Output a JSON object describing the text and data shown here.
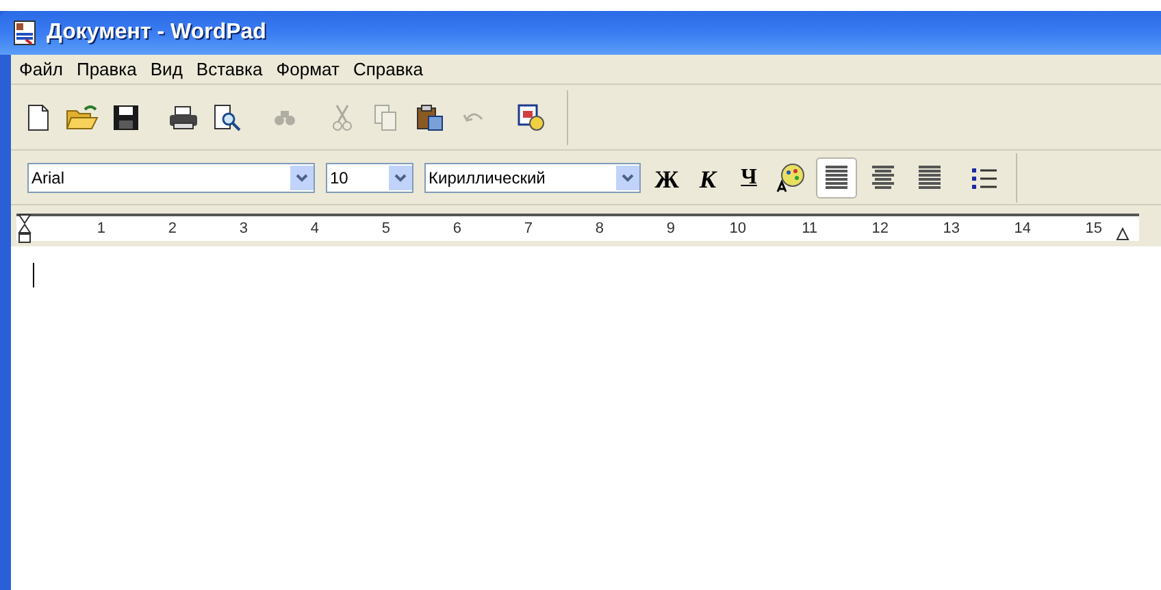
{
  "window": {
    "title": "Документ - WordPad"
  },
  "menu": [
    "Файл",
    "Правка",
    "Вид",
    "Вставка",
    "Формат",
    "Справка"
  ],
  "toolbar": [
    {
      "kind": "new",
      "disabled": false
    },
    {
      "kind": "open",
      "disabled": false
    },
    {
      "kind": "save",
      "disabled": false
    },
    {
      "kind": "sep"
    },
    {
      "kind": "print",
      "disabled": false
    },
    {
      "kind": "preview",
      "disabled": false
    },
    {
      "kind": "sep"
    },
    {
      "kind": "find",
      "disabled": true
    },
    {
      "kind": "sep"
    },
    {
      "kind": "cut",
      "disabled": true
    },
    {
      "kind": "copy",
      "disabled": true
    },
    {
      "kind": "paste",
      "disabled": false
    },
    {
      "kind": "undo",
      "disabled": true
    },
    {
      "kind": "sep"
    },
    {
      "kind": "datetime",
      "disabled": false
    }
  ],
  "format_bar": {
    "font": "Arial",
    "size": "10",
    "script": "Кириллический",
    "bold": "Ж",
    "italic": "К",
    "underline": "Ч",
    "align": [
      {
        "kind": "left",
        "selected": true
      },
      {
        "kind": "center",
        "selected": false
      },
      {
        "kind": "right",
        "selected": false
      }
    ]
  },
  "ruler": [
    "1",
    "2",
    "3",
    "4",
    "5",
    "6",
    "7",
    "8",
    "9",
    "10",
    "11",
    "12",
    "13",
    "14",
    "15"
  ]
}
